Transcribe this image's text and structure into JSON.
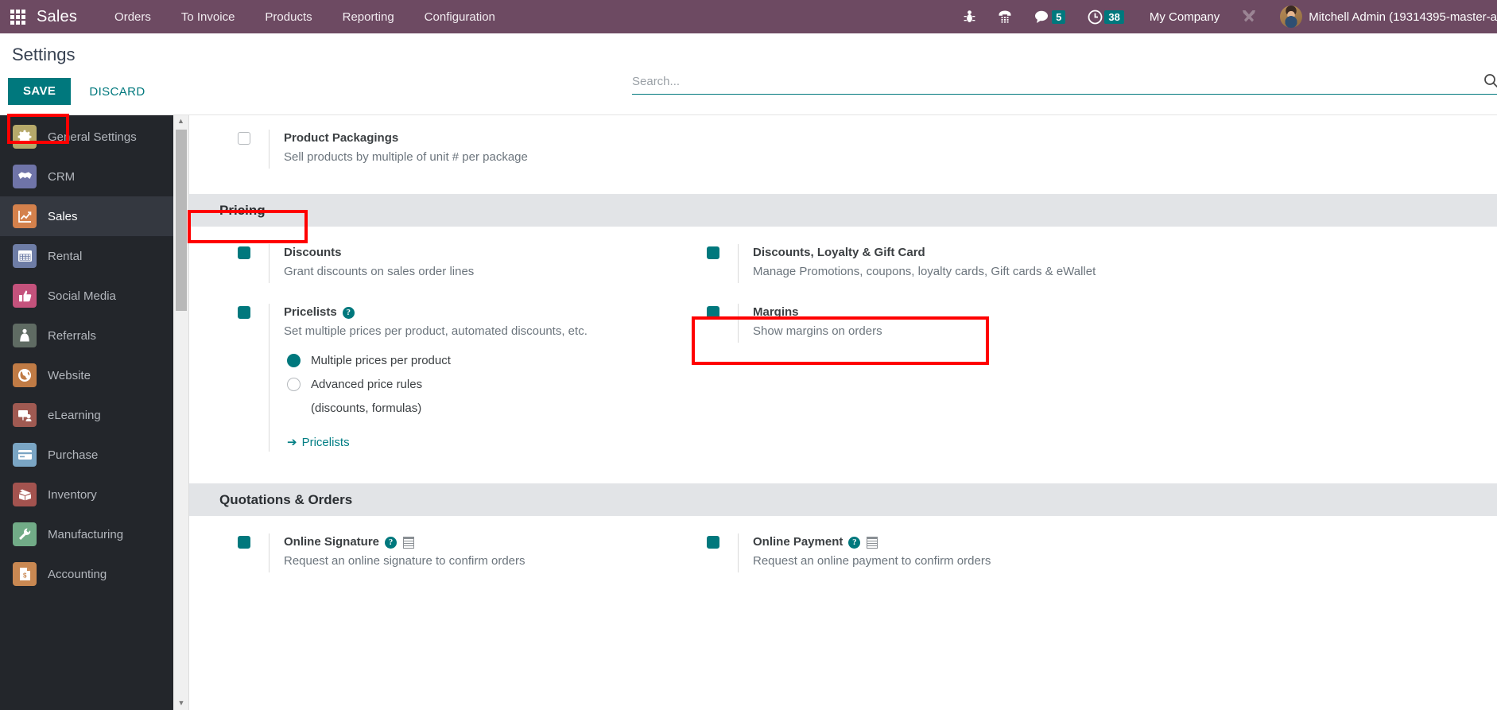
{
  "navbar": {
    "apps_icon": "apps-grid-icon",
    "brand": "Sales",
    "menu": [
      "Orders",
      "To Invoice",
      "Products",
      "Reporting",
      "Configuration"
    ],
    "icons": [
      {
        "name": "bug-icon",
        "label": ""
      },
      {
        "name": "voip-phone-icon",
        "label": ""
      }
    ],
    "messages_badge": "5",
    "activities_badge": "38",
    "company": "My Company",
    "tools_icon": "tools-icon",
    "username": "Mitchell Admin (19314395-master-a"
  },
  "control_panel": {
    "title": "Settings",
    "save_label": "SAVE",
    "discard_label": "DISCARD",
    "search_placeholder": "Search...",
    "search_value": ""
  },
  "sidebar": {
    "items": [
      {
        "label": "General Settings",
        "icon": "gear-icon",
        "color": "#b6a96a",
        "active": false
      },
      {
        "label": "CRM",
        "icon": "handshake-icon",
        "color": "#6f74a8",
        "active": false
      },
      {
        "label": "Sales",
        "icon": "chart-line-icon",
        "color": "#d4814c",
        "active": true
      },
      {
        "label": "Rental",
        "icon": "calendar-icon",
        "color": "#6e7da6",
        "active": false
      },
      {
        "label": "Social Media",
        "icon": "thumbs-up-icon",
        "color": "#c4527c",
        "active": false
      },
      {
        "label": "Referrals",
        "icon": "person-gift-icon",
        "color": "#5f6b63",
        "active": false
      },
      {
        "label": "Website",
        "icon": "globe-icon",
        "color": "#c07b45",
        "active": false
      },
      {
        "label": "eLearning",
        "icon": "presentation-icon",
        "color": "#a05a52",
        "active": false
      },
      {
        "label": "Purchase",
        "icon": "credit-card-icon",
        "color": "#7aa5c4",
        "active": false
      },
      {
        "label": "Inventory",
        "icon": "box-icon",
        "color": "#a3534f",
        "active": false
      },
      {
        "label": "Manufacturing",
        "icon": "wrench-icon",
        "color": "#71ab87",
        "active": false
      },
      {
        "label": "Accounting",
        "icon": "invoice-icon",
        "color": "#c98852",
        "active": false
      }
    ]
  },
  "settings": {
    "top_option": {
      "title": "Product Packagings",
      "desc": "Sell products by multiple of unit # per package",
      "checked": false
    },
    "pricing": {
      "heading": "Pricing",
      "options_left": [
        {
          "title": "Discounts",
          "desc": "Grant discounts on sales order lines",
          "checked": true
        },
        {
          "title": "Pricelists",
          "desc": "Set multiple prices per product, automated discounts, etc.",
          "checked": true,
          "help": "?"
        }
      ],
      "options_right": [
        {
          "title": "Discounts, Loyalty & Gift Card",
          "desc": "Manage Promotions, coupons, loyalty cards, Gift cards & eWallet",
          "checked": true
        },
        {
          "title": "Margins",
          "desc": "Show margins on orders",
          "checked": true
        }
      ],
      "radios": [
        {
          "label": "Multiple prices per product",
          "selected": true,
          "sub": ""
        },
        {
          "label": "Advanced price rules",
          "selected": false,
          "sub": "(discounts, formulas)"
        }
      ],
      "link": {
        "arrow": "➔",
        "label": "Pricelists"
      }
    },
    "quotations": {
      "heading": "Quotations & Orders",
      "options_left": [
        {
          "title": "Online Signature",
          "desc": "Request an online signature to confirm orders",
          "checked": true,
          "help": "?"
        }
      ],
      "options_right": [
        {
          "title": "Online Payment",
          "desc": "Request an online payment to confirm orders",
          "checked": true,
          "help": "?"
        }
      ]
    }
  },
  "annotations": {
    "save_box": "red-highlight-save",
    "pricing_box": "red-highlight-pricing",
    "margins_box": "red-highlight-margins"
  },
  "colors": {
    "navbar": "#6d4a62",
    "accent": "#00787d",
    "annotation": "#ff0000",
    "sidebar": "#23262b"
  }
}
